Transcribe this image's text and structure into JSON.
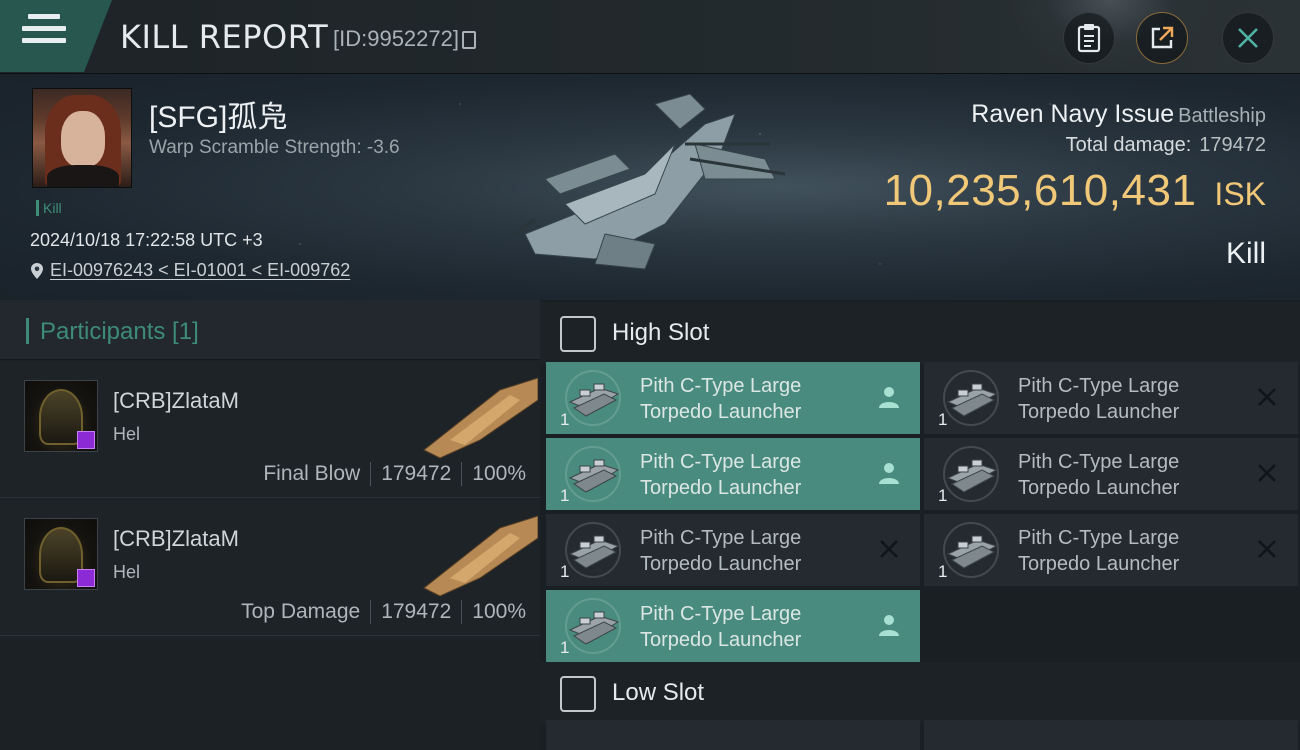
{
  "header": {
    "title": "KILL REPORT",
    "report_id": "[ID:9952272]"
  },
  "victim": {
    "name": "[SFG]孤凫",
    "warp_scramble": "Warp Scramble Strength: -3.6",
    "kill_tag": "Kill",
    "datetime": "2024/10/18 17:22:58 UTC +3",
    "location": "EI-00976243 < EI-01001 < EI-009762",
    "ship_name": "Raven Navy Issue",
    "ship_class": "Battleship",
    "total_damage_label": "Total damage:",
    "total_damage": "179472",
    "isk_value": "10,235,610,431",
    "isk_unit": "ISK",
    "result": "Kill"
  },
  "participants": {
    "title": "Participants [1]",
    "rows": [
      {
        "name": "[CRB]ZlataM",
        "ship": "Hel",
        "role": "Final Blow",
        "damage": "179472",
        "percent": "100%"
      },
      {
        "name": "[CRB]ZlataM",
        "ship": "Hel",
        "role": "Top Damage",
        "damage": "179472",
        "percent": "100%"
      }
    ]
  },
  "fitting": {
    "high_slot": {
      "title": "High Slot",
      "modules": [
        {
          "line1": "Pith C-Type Large",
          "line2": "Torpedo Launcher",
          "qty": "1",
          "state": "dropped"
        },
        {
          "line1": "Pith C-Type Large",
          "line2": "Torpedo Launcher",
          "qty": "1",
          "state": "destroyed"
        },
        {
          "line1": "Pith C-Type Large",
          "line2": "Torpedo Launcher",
          "qty": "1",
          "state": "dropped"
        },
        {
          "line1": "Pith C-Type Large",
          "line2": "Torpedo Launcher",
          "qty": "1",
          "state": "destroyed"
        },
        {
          "line1": "Pith C-Type Large",
          "line2": "Torpedo Launcher",
          "qty": "1",
          "state": "destroyed"
        },
        {
          "line1": "Pith C-Type Large",
          "line2": "Torpedo Launcher",
          "qty": "1",
          "state": "destroyed"
        },
        {
          "line1": "Pith C-Type Large",
          "line2": "Torpedo Launcher",
          "qty": "1",
          "state": "dropped"
        }
      ]
    },
    "low_slot": {
      "title": "Low Slot"
    }
  },
  "colors": {
    "accent": "#3e8b7a",
    "isk": "#f0c878",
    "active_module": "#4a8b7f"
  }
}
